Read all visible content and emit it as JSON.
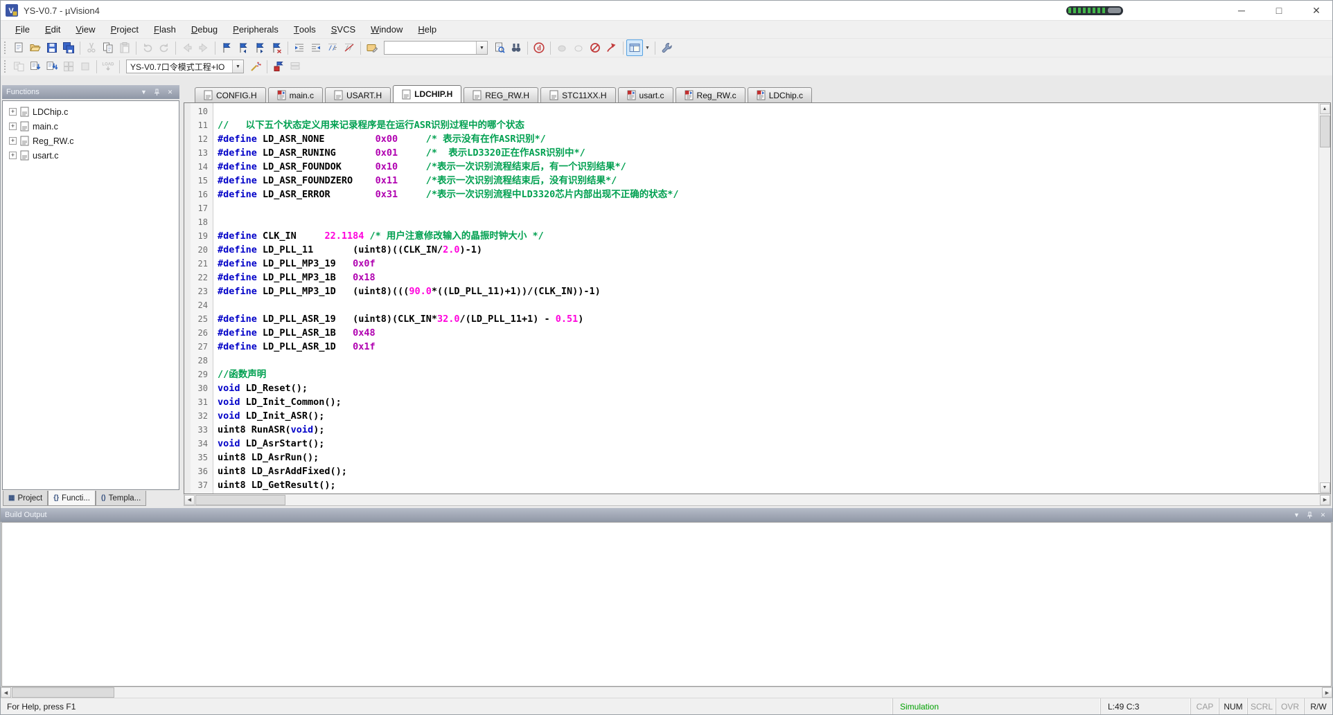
{
  "window": {
    "title": "YS-V0.7 - µVision4"
  },
  "menu": {
    "items": [
      "File",
      "Edit",
      "View",
      "Project",
      "Flash",
      "Debug",
      "Peripherals",
      "Tools",
      "SVCS",
      "Window",
      "Help"
    ]
  },
  "toolbar_main": {
    "search": {
      "value": "",
      "placeholder": ""
    },
    "items": [
      {
        "name": "new-file-icon"
      },
      {
        "name": "open-file-icon"
      },
      {
        "name": "save-icon"
      },
      {
        "name": "save-all-icon"
      },
      "sep",
      {
        "name": "cut-icon",
        "disabled": true
      },
      {
        "name": "copy-icon"
      },
      {
        "name": "paste-icon",
        "disabled": true
      },
      "sep",
      {
        "name": "undo-icon",
        "disabled": true
      },
      {
        "name": "redo-icon",
        "disabled": true
      },
      "sep",
      {
        "name": "navigate-back-icon",
        "disabled": true
      },
      {
        "name": "navigate-forward-icon",
        "disabled": true
      },
      "sep",
      {
        "name": "bookmark-toggle-icon"
      },
      {
        "name": "bookmark-prev-icon"
      },
      {
        "name": "bookmark-next-icon"
      },
      {
        "name": "bookmark-clear-icon"
      },
      "sep",
      {
        "name": "indent-right-icon"
      },
      {
        "name": "indent-left-icon"
      },
      {
        "name": "comment-selection-icon"
      },
      {
        "name": "uncomment-selection-icon"
      },
      "sep",
      {
        "name": "configure-folder-icon"
      },
      {
        "combo": "search"
      },
      {
        "name": "find-in-files-icon"
      },
      {
        "name": "find-icon"
      },
      "sep",
      {
        "name": "debug-session-icon"
      },
      "sep",
      {
        "name": "insert-breakpoint-icon",
        "disabled": true
      },
      {
        "name": "disable-breakpoint-icon",
        "disabled": true
      },
      {
        "name": "kill-breakpoints-icon"
      },
      {
        "name": "enable-breakpoints-icon"
      },
      "sep",
      {
        "name": "window-layout-icon",
        "boxed": true,
        "dropdown": true
      },
      "sep",
      {
        "name": "configure-wrench-icon"
      }
    ]
  },
  "toolbar_build": {
    "target_value": "YS-V0.7口令模式工程+IO",
    "items": [
      {
        "name": "translate-icon",
        "disabled": true
      },
      {
        "name": "build-icon"
      },
      {
        "name": "rebuild-icon"
      },
      {
        "name": "batch-build-icon",
        "disabled": true
      },
      {
        "name": "stop-build-icon",
        "disabled": true
      },
      "sep",
      {
        "name": "download-icon",
        "disabled": true
      },
      "sep",
      {
        "combo": "target"
      },
      {
        "name": "target-options-icon"
      },
      "sep",
      {
        "name": "file-extensions-icon"
      },
      {
        "name": "manage-components-icon",
        "disabled": true
      }
    ]
  },
  "functions_panel": {
    "title": "Functions",
    "files": [
      "LDChip.c",
      "main.c",
      "Reg_RW.c",
      "usart.c"
    ],
    "bottom_tabs": [
      {
        "label": "Project",
        "icon": "project-icon",
        "active": false
      },
      {
        "label": "Functi...",
        "icon": "functions-icon",
        "active": true
      },
      {
        "label": "Templa...",
        "icon": "templates-icon",
        "active": false
      }
    ]
  },
  "document_tabs": [
    {
      "label": "CONFIG.H",
      "modified": false,
      "active": false
    },
    {
      "label": "main.c",
      "modified": true,
      "active": false
    },
    {
      "label": "USART.H",
      "modified": false,
      "active": false
    },
    {
      "label": "LDCHIP.H",
      "modified": false,
      "active": true
    },
    {
      "label": "REG_RW.H",
      "modified": false,
      "active": false
    },
    {
      "label": "STC11XX.H",
      "modified": false,
      "active": false
    },
    {
      "label": "usart.c",
      "modified": true,
      "active": false
    },
    {
      "label": "Reg_RW.c",
      "modified": true,
      "active": false
    },
    {
      "label": "LDChip.c",
      "modified": true,
      "active": false
    }
  ],
  "editor": {
    "lines": [
      {
        "n": "10",
        "segs": []
      },
      {
        "n": "11",
        "segs": [
          {
            "c": "com",
            "t": "//   以下五个状态定义用来记录程序是在运行ASR识别过程中的哪个状态"
          }
        ]
      },
      {
        "n": "12",
        "segs": [
          {
            "c": "kw",
            "t": "#define"
          },
          {
            "c": "pl",
            "t": " "
          },
          {
            "c": "id",
            "t": "LD_ASR_NONE"
          },
          {
            "c": "pl",
            "t": "         "
          },
          {
            "c": "num",
            "t": "0x00"
          },
          {
            "c": "pl",
            "t": "     "
          },
          {
            "c": "com",
            "t": "/* 表示没有在作ASR识别*/"
          }
        ]
      },
      {
        "n": "13",
        "segs": [
          {
            "c": "kw",
            "t": "#define"
          },
          {
            "c": "pl",
            "t": " "
          },
          {
            "c": "id",
            "t": "LD_ASR_RUNING"
          },
          {
            "c": "pl",
            "t": "       "
          },
          {
            "c": "num",
            "t": "0x01"
          },
          {
            "c": "pl",
            "t": "     "
          },
          {
            "c": "com",
            "t": "/*  表示LD3320正在作ASR识别中*/"
          }
        ]
      },
      {
        "n": "14",
        "segs": [
          {
            "c": "kw",
            "t": "#define"
          },
          {
            "c": "pl",
            "t": " "
          },
          {
            "c": "id",
            "t": "LD_ASR_FOUNDOK"
          },
          {
            "c": "pl",
            "t": "      "
          },
          {
            "c": "num",
            "t": "0x10"
          },
          {
            "c": "pl",
            "t": "     "
          },
          {
            "c": "com",
            "t": "/*表示一次识别流程结束后，有一个识别结果*/"
          }
        ]
      },
      {
        "n": "15",
        "segs": [
          {
            "c": "kw",
            "t": "#define"
          },
          {
            "c": "pl",
            "t": " "
          },
          {
            "c": "id",
            "t": "LD_ASR_FOUNDZERO"
          },
          {
            "c": "pl",
            "t": "    "
          },
          {
            "c": "num",
            "t": "0x11"
          },
          {
            "c": "pl",
            "t": "     "
          },
          {
            "c": "com",
            "t": "/*表示一次识别流程结束后，没有识别结果*/"
          }
        ]
      },
      {
        "n": "16",
        "segs": [
          {
            "c": "kw",
            "t": "#define"
          },
          {
            "c": "pl",
            "t": " "
          },
          {
            "c": "id",
            "t": "LD_ASR_ERROR"
          },
          {
            "c": "pl",
            "t": "        "
          },
          {
            "c": "num",
            "t": "0x31"
          },
          {
            "c": "pl",
            "t": "     "
          },
          {
            "c": "com",
            "t": "/*表示一次识别流程中LD3320芯片内部出现不正确的状态*/"
          }
        ]
      },
      {
        "n": "17",
        "segs": []
      },
      {
        "n": "18",
        "segs": []
      },
      {
        "n": "19",
        "segs": [
          {
            "c": "kw",
            "t": "#define"
          },
          {
            "c": "pl",
            "t": " "
          },
          {
            "c": "id",
            "t": "CLK_IN"
          },
          {
            "c": "pl",
            "t": "     "
          },
          {
            "c": "flt",
            "t": "22.1184"
          },
          {
            "c": "pl",
            "t": " "
          },
          {
            "c": "com",
            "t": "/* 用户注意修改输入的晶振时钟大小 */"
          }
        ]
      },
      {
        "n": "20",
        "segs": [
          {
            "c": "kw",
            "t": "#define"
          },
          {
            "c": "pl",
            "t": " "
          },
          {
            "c": "id",
            "t": "LD_PLL_11"
          },
          {
            "c": "pl",
            "t": "       (uint8)((CLK_IN/"
          },
          {
            "c": "flt",
            "t": "2.0"
          },
          {
            "c": "pl",
            "t": ")-1)"
          }
        ]
      },
      {
        "n": "21",
        "segs": [
          {
            "c": "kw",
            "t": "#define"
          },
          {
            "c": "pl",
            "t": " "
          },
          {
            "c": "id",
            "t": "LD_PLL_MP3_19"
          },
          {
            "c": "pl",
            "t": "   "
          },
          {
            "c": "num",
            "t": "0x0f"
          }
        ]
      },
      {
        "n": "22",
        "segs": [
          {
            "c": "kw",
            "t": "#define"
          },
          {
            "c": "pl",
            "t": " "
          },
          {
            "c": "id",
            "t": "LD_PLL_MP3_1B"
          },
          {
            "c": "pl",
            "t": "   "
          },
          {
            "c": "num",
            "t": "0x18"
          }
        ]
      },
      {
        "n": "23",
        "segs": [
          {
            "c": "kw",
            "t": "#define"
          },
          {
            "c": "pl",
            "t": " "
          },
          {
            "c": "id",
            "t": "LD_PLL_MP3_1D"
          },
          {
            "c": "pl",
            "t": "   (uint8)((("
          },
          {
            "c": "flt",
            "t": "90.0"
          },
          {
            "c": "pl",
            "t": "*((LD_PLL_11)+1))/(CLK_IN))-1)"
          }
        ]
      },
      {
        "n": "24",
        "segs": []
      },
      {
        "n": "25",
        "segs": [
          {
            "c": "kw",
            "t": "#define"
          },
          {
            "c": "pl",
            "t": " "
          },
          {
            "c": "id",
            "t": "LD_PLL_ASR_19"
          },
          {
            "c": "pl",
            "t": "   (uint8)(CLK_IN*"
          },
          {
            "c": "flt",
            "t": "32.0"
          },
          {
            "c": "pl",
            "t": "/(LD_PLL_11+1) - "
          },
          {
            "c": "flt",
            "t": "0.51"
          },
          {
            "c": "pl",
            "t": ")"
          }
        ]
      },
      {
        "n": "26",
        "segs": [
          {
            "c": "kw",
            "t": "#define"
          },
          {
            "c": "pl",
            "t": " "
          },
          {
            "c": "id",
            "t": "LD_PLL_ASR_1B"
          },
          {
            "c": "pl",
            "t": "   "
          },
          {
            "c": "num",
            "t": "0x48"
          }
        ]
      },
      {
        "n": "27",
        "segs": [
          {
            "c": "kw",
            "t": "#define"
          },
          {
            "c": "pl",
            "t": " "
          },
          {
            "c": "id",
            "t": "LD_PLL_ASR_1D"
          },
          {
            "c": "pl",
            "t": "   "
          },
          {
            "c": "num",
            "t": "0x1f"
          }
        ]
      },
      {
        "n": "28",
        "segs": []
      },
      {
        "n": "29",
        "segs": [
          {
            "c": "com",
            "t": "//函数声明"
          }
        ]
      },
      {
        "n": "30",
        "segs": [
          {
            "c": "kw",
            "t": "void"
          },
          {
            "c": "pl",
            "t": " LD_Reset();"
          }
        ]
      },
      {
        "n": "31",
        "segs": [
          {
            "c": "kw",
            "t": "void"
          },
          {
            "c": "pl",
            "t": " LD_Init_Common();"
          }
        ]
      },
      {
        "n": "32",
        "segs": [
          {
            "c": "kw",
            "t": "void"
          },
          {
            "c": "pl",
            "t": " LD_Init_ASR();"
          }
        ]
      },
      {
        "n": "33",
        "segs": [
          {
            "c": "pl",
            "t": "uint8 RunASR("
          },
          {
            "c": "kw",
            "t": "void"
          },
          {
            "c": "pl",
            "t": ");"
          }
        ]
      },
      {
        "n": "34",
        "segs": [
          {
            "c": "kw",
            "t": "void"
          },
          {
            "c": "pl",
            "t": " LD_AsrStart();"
          }
        ]
      },
      {
        "n": "35",
        "segs": [
          {
            "c": "pl",
            "t": "uint8 LD_AsrRun();"
          }
        ]
      },
      {
        "n": "36",
        "segs": [
          {
            "c": "pl",
            "t": "uint8 LD_AsrAddFixed();"
          }
        ]
      },
      {
        "n": "37",
        "segs": [
          {
            "c": "pl",
            "t": "uint8 LD_GetResult();"
          }
        ]
      }
    ]
  },
  "build_output": {
    "title": "Build Output"
  },
  "status": {
    "help_text": "For Help, press F1",
    "mode": "Simulation",
    "cursor": "L:49 C:3",
    "toggles": [
      {
        "label": "CAP",
        "on": false
      },
      {
        "label": "NUM",
        "on": true
      },
      {
        "label": "SCRL",
        "on": false
      },
      {
        "label": "OVR",
        "on": false
      },
      {
        "label": "R/W",
        "on": true
      }
    ]
  }
}
